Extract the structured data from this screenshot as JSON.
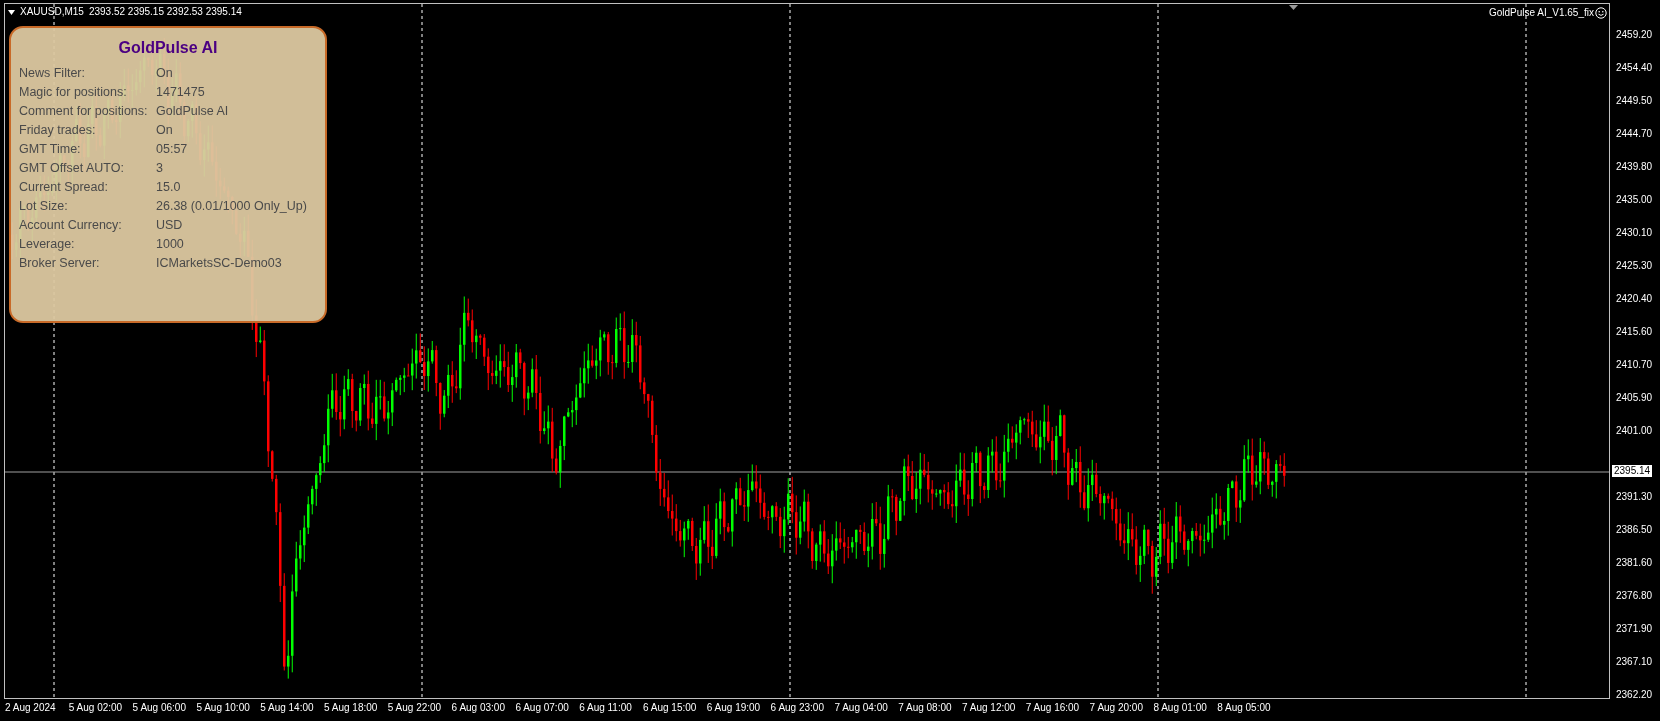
{
  "chart": {
    "header": {
      "symbol": "XAUUSD,M15",
      "ohlc": "2393.52 2395.15 2392.53 2395.14"
    },
    "expert_label": "GoldPulse AI_V1.65_fix",
    "upper_price_ticks": [
      "2459.20",
      "2454.40",
      "2449.50",
      "2444.70",
      "2439.80",
      "2435.00",
      "2430.10",
      "2425.30",
      "2420.40",
      "2415.60",
      "2410.70",
      "2405.90",
      "2401.00"
    ],
    "current_price": "2395.14",
    "lower_price_ticks": [
      "2391.30",
      "2386.50",
      "2381.60",
      "2376.80",
      "2371.90",
      "2367.10",
      "2362.20"
    ],
    "time_ticks": [
      "2 Aug 2024",
      "5 Aug 02:00",
      "5 Aug 06:00",
      "5 Aug 10:00",
      "5 Aug 14:00",
      "5 Aug 18:00",
      "5 Aug 22:00",
      "6 Aug 03:00",
      "6 Aug 07:00",
      "6 Aug 11:00",
      "6 Aug 15:00",
      "6 Aug 19:00",
      "6 Aug 23:00",
      "7 Aug 04:00",
      "7 Aug 08:00",
      "7 Aug 12:00",
      "7 Aug 16:00",
      "7 Aug 20:00",
      "8 Aug 01:00",
      "8 Aug 05:00"
    ]
  },
  "panel": {
    "title": "GoldPulse AI",
    "rows": [
      {
        "label": "News Filter:",
        "value": "On"
      },
      {
        "label": "Magic for positions:",
        "value": "1471475"
      },
      {
        "label": "Comment for positions:",
        "value": "GoldPulse AI"
      },
      {
        "label": "Friday trades:",
        "value": "On"
      },
      {
        "label": "GMT Time:",
        "value": "05:57"
      },
      {
        "label": "GMT Offset AUTO:",
        "value": "3"
      },
      {
        "label": "Current Spread:",
        "value": "15.0"
      },
      {
        "label": "Lot Size:",
        "value": "26.38 (0.01/1000 Only_Up)"
      },
      {
        "label": "Account Currency:",
        "value": "USD"
      },
      {
        "label": "Leverage:",
        "value": "1000"
      },
      {
        "label": "Broker Server:",
        "value": "ICMarketsSC-Demo03"
      }
    ]
  }
}
